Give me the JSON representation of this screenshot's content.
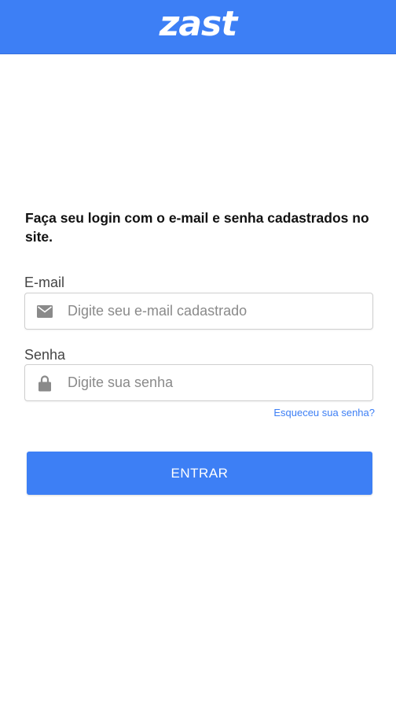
{
  "header": {
    "logo_text": "zast",
    "background_color": "#3d7ff5"
  },
  "intro": {
    "text": "Faça seu login com o e-mail e senha cadastrados no site."
  },
  "form": {
    "email": {
      "label": "E-mail",
      "placeholder": "Digite seu e-mail cadastrado",
      "value": "",
      "icon": "envelope-icon"
    },
    "password": {
      "label": "Senha",
      "placeholder": "Digite sua senha",
      "value": "",
      "icon": "lock-icon"
    },
    "forgot_password_link": "Esqueceu sua senha?",
    "submit_label": "ENTRAR"
  },
  "colors": {
    "accent": "#3d7ff5",
    "link": "#3d7ff5",
    "icon_gray": "#8a8a8a"
  }
}
